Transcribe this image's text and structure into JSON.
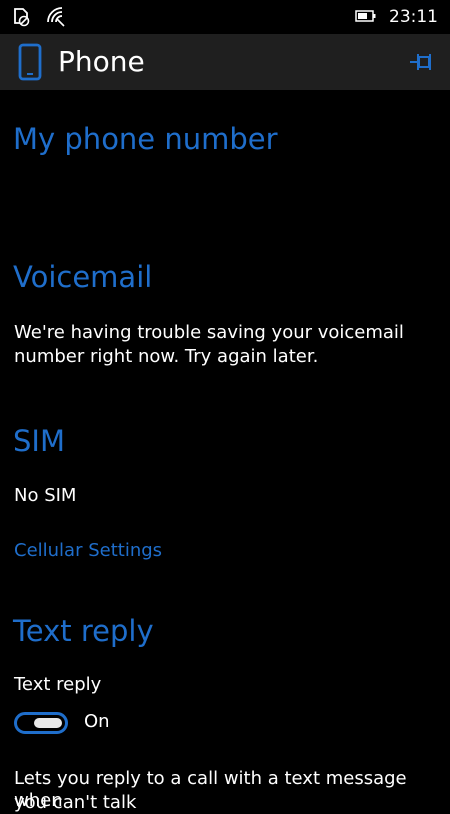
{
  "status_bar": {
    "time": "23:11",
    "icons": [
      "no-sim-icon",
      "wifi-icon",
      "battery-icon"
    ]
  },
  "header": {
    "title": "Phone",
    "app_icon": "phone-icon",
    "pin_icon": "pin-icon"
  },
  "sections": {
    "my_number": {
      "title": "My phone number"
    },
    "voicemail": {
      "title": "Voicemail",
      "message_line1": "We're having trouble saving your voicemail",
      "message_line2": "number right now. Try again later."
    },
    "sim": {
      "title": "SIM",
      "status": "No SIM",
      "link": "Cellular Settings"
    },
    "text_reply": {
      "title": "Text reply",
      "label": "Text reply",
      "toggle_state": "On",
      "toggle_on": true,
      "description_line1": "Lets you reply to a call with a text message when",
      "description_line2": "you can't talk"
    }
  },
  "colors": {
    "accent": "#1f6ecb",
    "header_bg": "#1f1f1f",
    "background": "#000000",
    "text": "#ffffff"
  }
}
